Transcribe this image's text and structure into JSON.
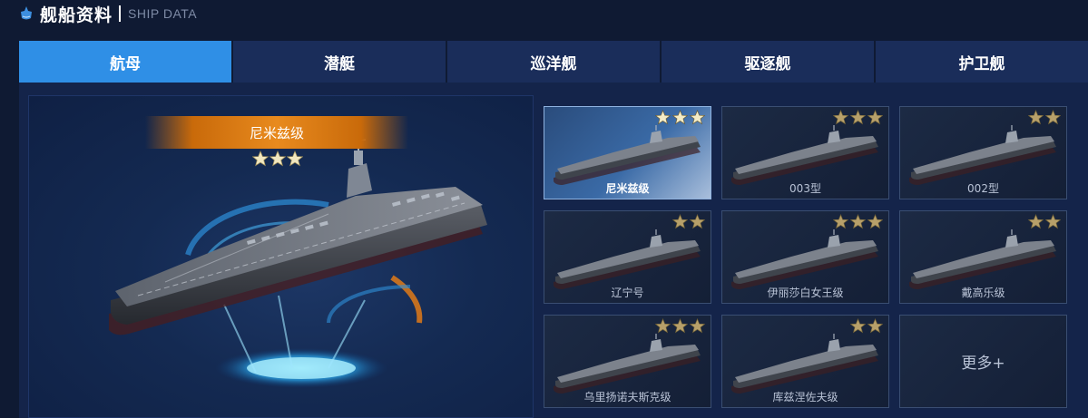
{
  "header": {
    "title": "舰船资料",
    "subtitle": "SHIP DATA"
  },
  "tabs": [
    {
      "label": "航母",
      "active": true
    },
    {
      "label": "潜艇",
      "active": false
    },
    {
      "label": "巡洋舰",
      "active": false
    },
    {
      "label": "驱逐舰",
      "active": false
    },
    {
      "label": "护卫舰",
      "active": false
    }
  ],
  "featured": {
    "name": "尼米兹级",
    "stars": 3
  },
  "ships": [
    {
      "name": "尼米兹级",
      "stars": 3,
      "selected": true
    },
    {
      "name": "003型",
      "stars": 3,
      "selected": false
    },
    {
      "name": "002型",
      "stars": 2,
      "selected": false
    },
    {
      "name": "辽宁号",
      "stars": 2,
      "selected": false
    },
    {
      "name": "伊丽莎白女王级",
      "stars": 3,
      "selected": false
    },
    {
      "name": "戴高乐级",
      "stars": 2,
      "selected": false
    },
    {
      "name": "乌里扬诺夫斯克级",
      "stars": 3,
      "selected": false
    },
    {
      "name": "库兹涅佐夫级",
      "stars": 2,
      "selected": false
    }
  ],
  "more_label": "更多+",
  "colors": {
    "background": "#0f1a33",
    "tab": "#1a2d5a",
    "tab_active": "#2f8fe6",
    "banner": "#e88a1e",
    "star": "#e7d9a8"
  }
}
